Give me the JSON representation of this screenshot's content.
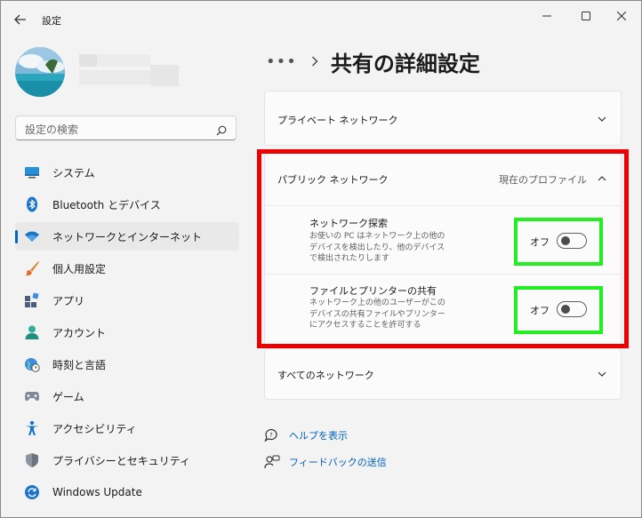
{
  "window": {
    "title": "設定",
    "controls": [
      "minimize",
      "maximize",
      "close"
    ]
  },
  "search": {
    "placeholder": "設定の検索"
  },
  "sidebar": {
    "items": [
      {
        "label": "システム",
        "icon": "system-icon",
        "selected": false
      },
      {
        "label": "Bluetooth とデバイス",
        "icon": "bluetooth-icon",
        "selected": false
      },
      {
        "label": "ネットワークとインターネット",
        "icon": "wifi-icon",
        "selected": true
      },
      {
        "label": "個人用設定",
        "icon": "brush-icon",
        "selected": false
      },
      {
        "label": "アプリ",
        "icon": "apps-icon",
        "selected": false
      },
      {
        "label": "アカウント",
        "icon": "account-icon",
        "selected": false
      },
      {
        "label": "時刻と言語",
        "icon": "clock-globe-icon",
        "selected": false
      },
      {
        "label": "ゲーム",
        "icon": "gamepad-icon",
        "selected": false
      },
      {
        "label": "アクセシビリティ",
        "icon": "accessibility-icon",
        "selected": false
      },
      {
        "label": "プライバシーとセキュリティ",
        "icon": "shield-icon",
        "selected": false
      },
      {
        "label": "Windows Update",
        "icon": "update-icon",
        "selected": false
      }
    ]
  },
  "header": {
    "breadcrumb_more": "•••",
    "title": "共有の詳細設定"
  },
  "sections": {
    "private": {
      "title": "プライベート ネットワーク",
      "expanded": false
    },
    "public": {
      "title": "パブリック ネットワーク",
      "profile": "現在のプロファイル",
      "expanded": true,
      "discovery": {
        "title": "ネットワーク探索",
        "desc": "お使いの PC はネットワーク上の他のデバイスを検出したり、他のデバイスで検出されたりします",
        "state_label": "オフ",
        "on": false
      },
      "sharing": {
        "title": "ファイルとプリンターの共有",
        "desc": "ネットワーク上の他のユーザーがこのデバイスの共有ファイルやプリンターにアクセスすることを許可する",
        "state_label": "オフ",
        "on": false
      }
    },
    "all": {
      "title": "すべてのネットワーク",
      "expanded": false
    }
  },
  "links": {
    "help": "ヘルプを表示",
    "feedback": "フィードバックの送信"
  },
  "colors": {
    "accent": "#0067c0",
    "highlight_red": "#ee0000",
    "highlight_green": "#22ee22"
  }
}
